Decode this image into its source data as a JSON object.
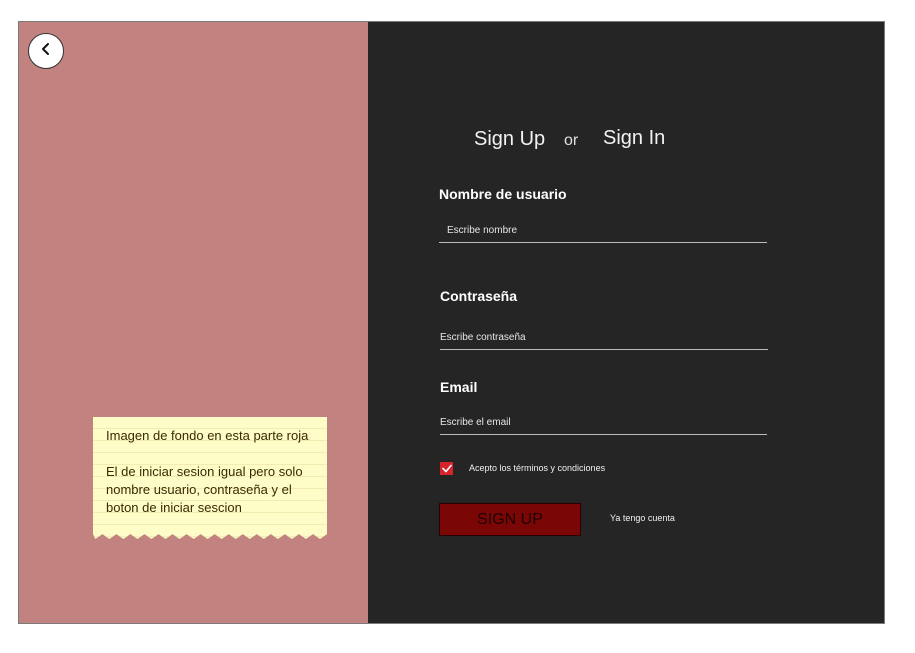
{
  "note": {
    "line1": "Imagen de fondo en esta parte roja",
    "line2": "El de iniciar sesion igual pero solo nombre usuario, contraseña y el boton de iniciar sescion"
  },
  "tabs": {
    "signup": "Sign Up",
    "or": "or",
    "signin": "Sign In"
  },
  "form": {
    "username": {
      "label": "Nombre de usuario",
      "placeholder": "Escribe nombre"
    },
    "password": {
      "label": "Contraseña",
      "placeholder": "Escribe contraseña"
    },
    "email": {
      "label": "Email",
      "placeholder": "Escribe el email"
    },
    "terms": "Acepto los términos y condiciones",
    "terms_checked": true,
    "submit": "SIGN UP",
    "have_account": "Ya tengo cuenta"
  },
  "icons": {
    "back": "chevron-left-icon",
    "check": "check-icon"
  },
  "colors": {
    "left_bg": "#c28380",
    "right_bg": "#252525",
    "accent": "#7a0706",
    "checkbox": "#d8232a"
  }
}
